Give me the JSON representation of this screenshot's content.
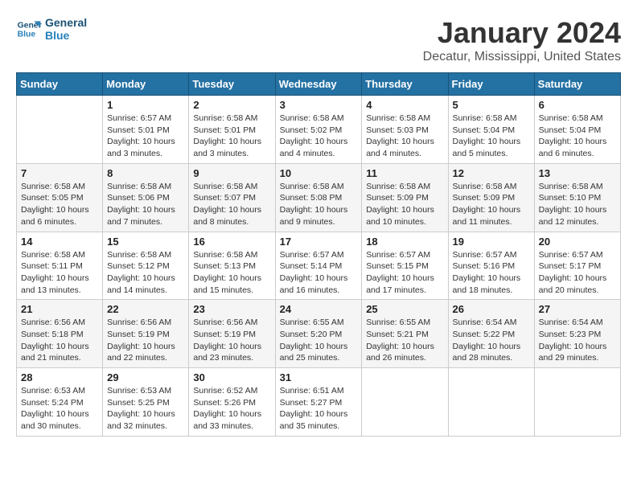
{
  "logo": {
    "line1": "General",
    "line2": "Blue"
  },
  "title": "January 2024",
  "subtitle": "Decatur, Mississippi, United States",
  "weekdays": [
    "Sunday",
    "Monday",
    "Tuesday",
    "Wednesday",
    "Thursday",
    "Friday",
    "Saturday"
  ],
  "weeks": [
    [
      {
        "day": "",
        "info": ""
      },
      {
        "day": "1",
        "info": "Sunrise: 6:57 AM\nSunset: 5:01 PM\nDaylight: 10 hours\nand 3 minutes."
      },
      {
        "day": "2",
        "info": "Sunrise: 6:58 AM\nSunset: 5:01 PM\nDaylight: 10 hours\nand 3 minutes."
      },
      {
        "day": "3",
        "info": "Sunrise: 6:58 AM\nSunset: 5:02 PM\nDaylight: 10 hours\nand 4 minutes."
      },
      {
        "day": "4",
        "info": "Sunrise: 6:58 AM\nSunset: 5:03 PM\nDaylight: 10 hours\nand 4 minutes."
      },
      {
        "day": "5",
        "info": "Sunrise: 6:58 AM\nSunset: 5:04 PM\nDaylight: 10 hours\nand 5 minutes."
      },
      {
        "day": "6",
        "info": "Sunrise: 6:58 AM\nSunset: 5:04 PM\nDaylight: 10 hours\nand 6 minutes."
      }
    ],
    [
      {
        "day": "7",
        "info": "Sunrise: 6:58 AM\nSunset: 5:05 PM\nDaylight: 10 hours\nand 6 minutes."
      },
      {
        "day": "8",
        "info": "Sunrise: 6:58 AM\nSunset: 5:06 PM\nDaylight: 10 hours\nand 7 minutes."
      },
      {
        "day": "9",
        "info": "Sunrise: 6:58 AM\nSunset: 5:07 PM\nDaylight: 10 hours\nand 8 minutes."
      },
      {
        "day": "10",
        "info": "Sunrise: 6:58 AM\nSunset: 5:08 PM\nDaylight: 10 hours\nand 9 minutes."
      },
      {
        "day": "11",
        "info": "Sunrise: 6:58 AM\nSunset: 5:09 PM\nDaylight: 10 hours\nand 10 minutes."
      },
      {
        "day": "12",
        "info": "Sunrise: 6:58 AM\nSunset: 5:09 PM\nDaylight: 10 hours\nand 11 minutes."
      },
      {
        "day": "13",
        "info": "Sunrise: 6:58 AM\nSunset: 5:10 PM\nDaylight: 10 hours\nand 12 minutes."
      }
    ],
    [
      {
        "day": "14",
        "info": "Sunrise: 6:58 AM\nSunset: 5:11 PM\nDaylight: 10 hours\nand 13 minutes."
      },
      {
        "day": "15",
        "info": "Sunrise: 6:58 AM\nSunset: 5:12 PM\nDaylight: 10 hours\nand 14 minutes."
      },
      {
        "day": "16",
        "info": "Sunrise: 6:58 AM\nSunset: 5:13 PM\nDaylight: 10 hours\nand 15 minutes."
      },
      {
        "day": "17",
        "info": "Sunrise: 6:57 AM\nSunset: 5:14 PM\nDaylight: 10 hours\nand 16 minutes."
      },
      {
        "day": "18",
        "info": "Sunrise: 6:57 AM\nSunset: 5:15 PM\nDaylight: 10 hours\nand 17 minutes."
      },
      {
        "day": "19",
        "info": "Sunrise: 6:57 AM\nSunset: 5:16 PM\nDaylight: 10 hours\nand 18 minutes."
      },
      {
        "day": "20",
        "info": "Sunrise: 6:57 AM\nSunset: 5:17 PM\nDaylight: 10 hours\nand 20 minutes."
      }
    ],
    [
      {
        "day": "21",
        "info": "Sunrise: 6:56 AM\nSunset: 5:18 PM\nDaylight: 10 hours\nand 21 minutes."
      },
      {
        "day": "22",
        "info": "Sunrise: 6:56 AM\nSunset: 5:19 PM\nDaylight: 10 hours\nand 22 minutes."
      },
      {
        "day": "23",
        "info": "Sunrise: 6:56 AM\nSunset: 5:19 PM\nDaylight: 10 hours\nand 23 minutes."
      },
      {
        "day": "24",
        "info": "Sunrise: 6:55 AM\nSunset: 5:20 PM\nDaylight: 10 hours\nand 25 minutes."
      },
      {
        "day": "25",
        "info": "Sunrise: 6:55 AM\nSunset: 5:21 PM\nDaylight: 10 hours\nand 26 minutes."
      },
      {
        "day": "26",
        "info": "Sunrise: 6:54 AM\nSunset: 5:22 PM\nDaylight: 10 hours\nand 28 minutes."
      },
      {
        "day": "27",
        "info": "Sunrise: 6:54 AM\nSunset: 5:23 PM\nDaylight: 10 hours\nand 29 minutes."
      }
    ],
    [
      {
        "day": "28",
        "info": "Sunrise: 6:53 AM\nSunset: 5:24 PM\nDaylight: 10 hours\nand 30 minutes."
      },
      {
        "day": "29",
        "info": "Sunrise: 6:53 AM\nSunset: 5:25 PM\nDaylight: 10 hours\nand 32 minutes."
      },
      {
        "day": "30",
        "info": "Sunrise: 6:52 AM\nSunset: 5:26 PM\nDaylight: 10 hours\nand 33 minutes."
      },
      {
        "day": "31",
        "info": "Sunrise: 6:51 AM\nSunset: 5:27 PM\nDaylight: 10 hours\nand 35 minutes."
      },
      {
        "day": "",
        "info": ""
      },
      {
        "day": "",
        "info": ""
      },
      {
        "day": "",
        "info": ""
      }
    ]
  ]
}
